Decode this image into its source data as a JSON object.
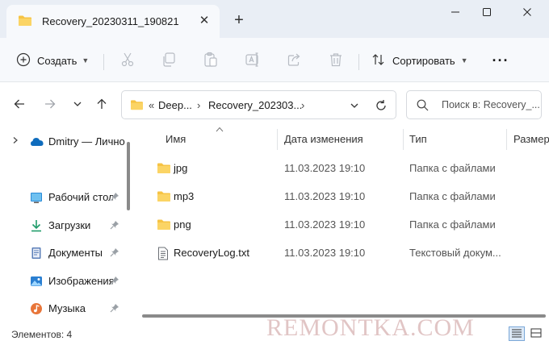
{
  "window": {
    "tab_title": "Recovery_20230311_190821",
    "tab_close": "✕",
    "new_tab": "+",
    "minimize": "—",
    "maximize": "☐",
    "close": "✕"
  },
  "toolbar": {
    "create_label": "Создать",
    "sort_label": "Сортировать",
    "more_label": "···",
    "icons": [
      "plus-circle-icon",
      "cut-icon",
      "copy-icon",
      "paste-icon",
      "rename-icon",
      "share-icon",
      "delete-icon",
      "sort-icon"
    ]
  },
  "address": {
    "overflow": "«",
    "segments": [
      "Deep...",
      "Recovery_202303..."
    ],
    "separator": "›"
  },
  "search": {
    "placeholder": "Поиск в: Recovery_..."
  },
  "sidebar": {
    "items": [
      {
        "label": "Dmitry — Личное",
        "icon": "onedrive-cloud-icon"
      },
      {
        "label": "Рабочий стол",
        "icon": "desktop-icon"
      },
      {
        "label": "Загрузки",
        "icon": "downloads-icon"
      },
      {
        "label": "Документы",
        "icon": "documents-icon"
      },
      {
        "label": "Изображения",
        "icon": "pictures-icon"
      },
      {
        "label": "Музыка",
        "icon": "music-icon"
      }
    ]
  },
  "columns": {
    "name": "Имя",
    "date": "Дата изменения",
    "type": "Тип",
    "size": "Размер"
  },
  "files": [
    {
      "name": "jpg",
      "date": "11.03.2023 19:10",
      "type": "Папка с файлами",
      "icon": "folder-icon"
    },
    {
      "name": "mp3",
      "date": "11.03.2023 19:10",
      "type": "Папка с файлами",
      "icon": "folder-icon"
    },
    {
      "name": "png",
      "date": "11.03.2023 19:10",
      "type": "Папка с файлами",
      "icon": "folder-icon"
    },
    {
      "name": "RecoveryLog.txt",
      "date": "11.03.2023 19:10",
      "type": "Текстовый докум...",
      "icon": "text-file-icon"
    }
  ],
  "status": {
    "items_count": "Элементов: 4"
  },
  "watermark": "REMONTKA.COM",
  "colors": {
    "titlebar_bg": "#e9eef5",
    "toolbar_bg": "#f7f9fc",
    "folder_yellow": "#f6c344",
    "accent_blue": "#0067c0"
  }
}
